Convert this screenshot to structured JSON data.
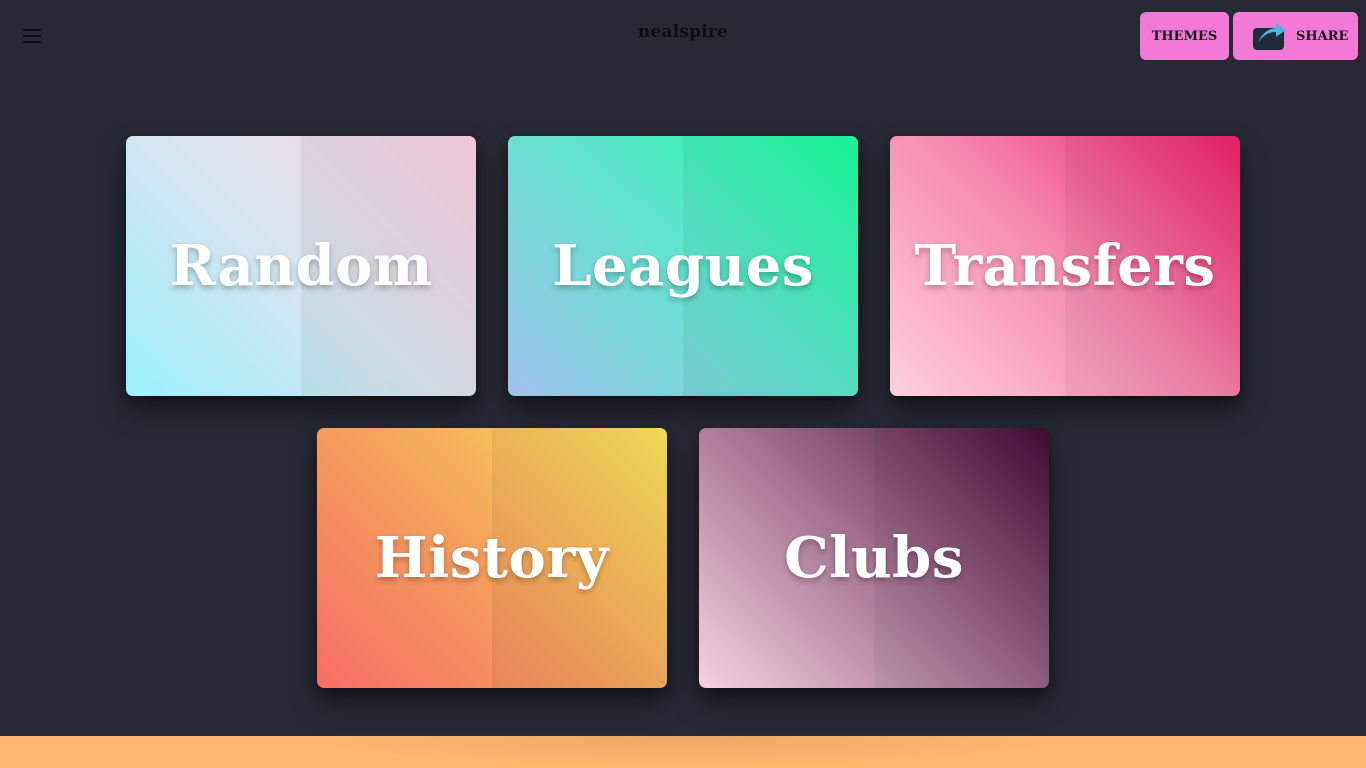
{
  "header": {
    "brand": "nealspire",
    "themes_label": "THEMES",
    "share_label": "SHARE",
    "menu_icon": "hamburger-menu-icon",
    "share_icon": "share-arrow-icon",
    "accent_color": "#f27ad6"
  },
  "categories": [
    {
      "label": "Random",
      "gradient": [
        "#9cf0fd",
        "#fcd0e1"
      ]
    },
    {
      "label": "Leagues",
      "gradient": [
        "#a0c2ec",
        "#17ff9c"
      ]
    },
    {
      "label": "Transfers",
      "gradient": [
        "#fdd0dd",
        "#ea2167"
      ]
    },
    {
      "label": "History",
      "gradient": [
        "#f66d66",
        "#f7e35a"
      ]
    },
    {
      "label": "Clubs",
      "gradient": [
        "#fad1e0",
        "#420b32"
      ]
    }
  ],
  "theme": {
    "background": "#272a35",
    "footer_strip": "#ffb86e"
  }
}
